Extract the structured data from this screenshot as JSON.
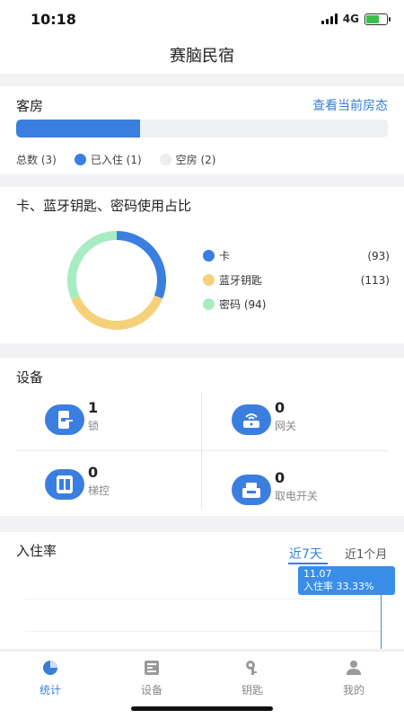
{
  "status": {
    "time": "10:18",
    "network": "4G"
  },
  "header": {
    "title": "赛脑民宿"
  },
  "rooms": {
    "title": "客房",
    "link": "查看当前房态",
    "occupied_fraction": 0.333,
    "total_label": "总数 (3)",
    "occupied_label": "已入住 (1)",
    "vacant_label": "空房 (2)",
    "occupied_color": "#3a7fe0",
    "vacant_color": "#eeeeee"
  },
  "ratio": {
    "title": "卡、蓝牙钥匙、密码使用占比",
    "items": [
      {
        "label": "卡",
        "value_label": "(93)",
        "color": "#3a7fe0"
      },
      {
        "label": "蓝牙钥匙",
        "value_label": "(113)",
        "color": "#f5d27a"
      },
      {
        "label": "密码 (94)",
        "value_label": "",
        "color": "#a8ecc4"
      }
    ]
  },
  "chart_data": {
    "type": "pie",
    "categories": [
      "卡",
      "蓝牙钥匙",
      "密码"
    ],
    "values": [
      93,
      113,
      94
    ],
    "title": "卡、蓝牙钥匙、密码使用占比",
    "donut": true,
    "colors": [
      "#3a7fe0",
      "#f5d27a",
      "#a8ecc4"
    ],
    "legend": "right"
  },
  "devices": {
    "title": "设备",
    "items": [
      {
        "count": "1",
        "label": "锁",
        "icon": "lock-icon"
      },
      {
        "count": "0",
        "label": "网关",
        "icon": "gateway-icon"
      },
      {
        "count": "0",
        "label": "梯控",
        "icon": "elevator-icon"
      },
      {
        "count": "0",
        "label": "取电开关",
        "icon": "power-switch-icon"
      }
    ]
  },
  "occupancy": {
    "title": "入住率",
    "tab_7": "近7天",
    "tab_month": "近1个月",
    "tooltip_date": "11.07",
    "tooltip_value": "入住率 33.33%"
  },
  "tabs": [
    {
      "label": "统计",
      "icon": "pie-chart-icon",
      "active": true
    },
    {
      "label": "设备",
      "icon": "device-icon",
      "active": false
    },
    {
      "label": "钥匙",
      "icon": "key-icon",
      "active": false
    },
    {
      "label": "我的",
      "icon": "user-icon",
      "active": false
    }
  ]
}
